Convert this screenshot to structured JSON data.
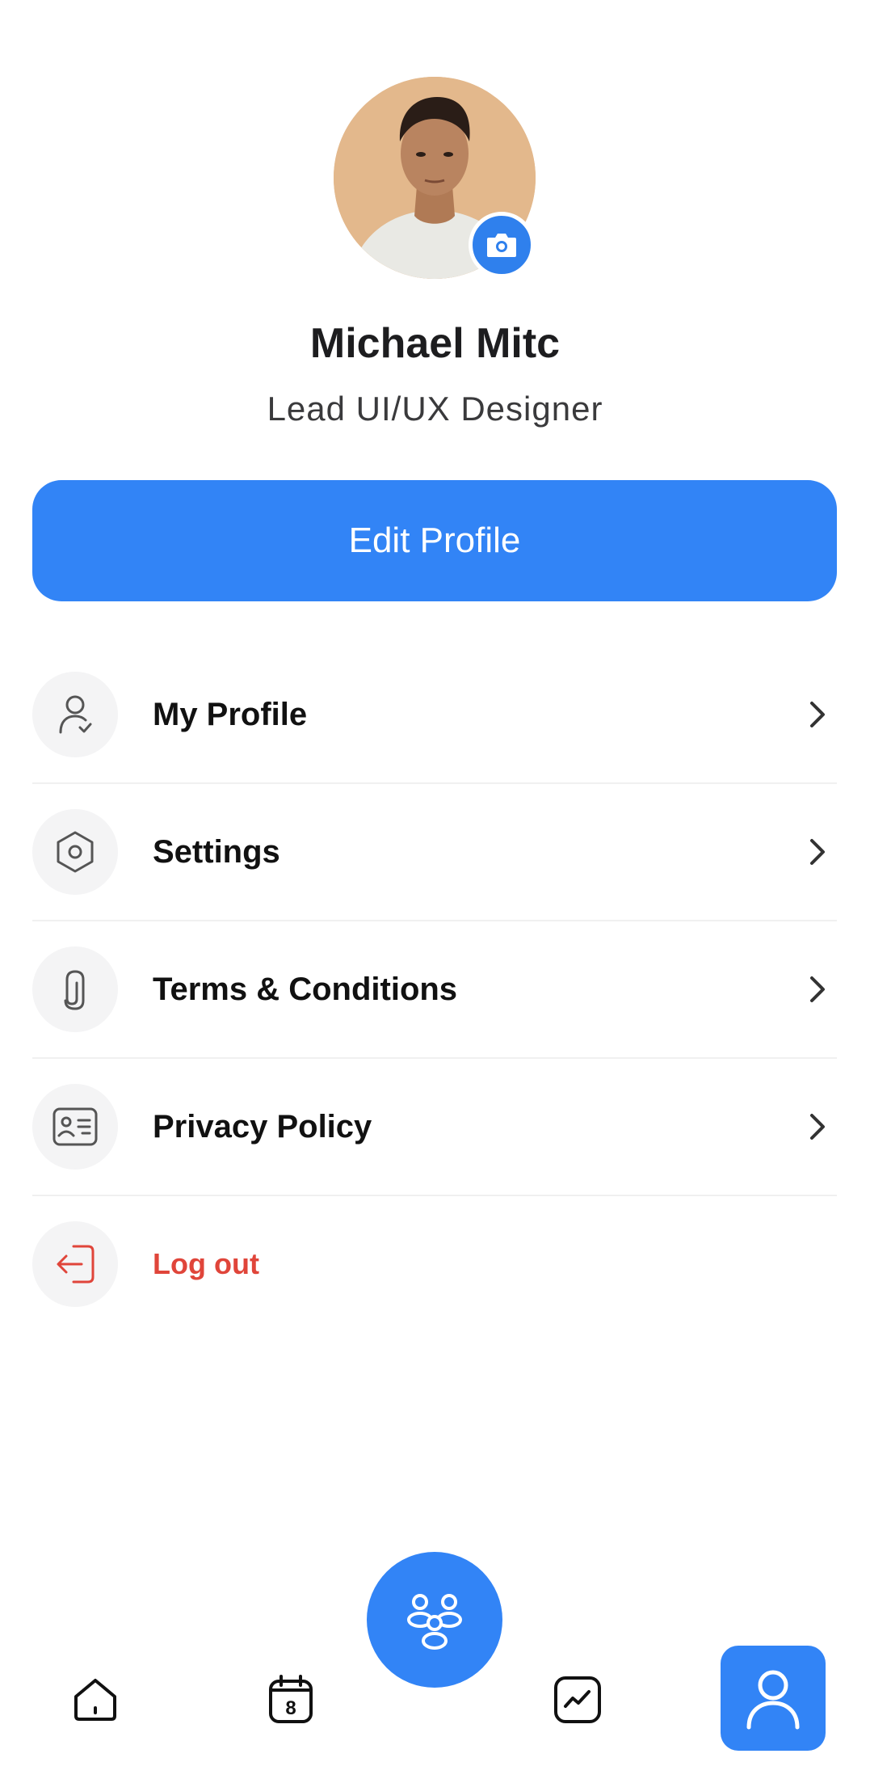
{
  "profile": {
    "name": "Michael Mitc",
    "role": "Lead UI/UX Designer",
    "edit_label": "Edit Profile"
  },
  "menu": {
    "items": [
      {
        "label": "My Profile",
        "icon": "user-check-icon"
      },
      {
        "label": "Settings",
        "icon": "settings-hexagon-icon"
      },
      {
        "label": "Terms & Conditions",
        "icon": "paperclip-icon"
      },
      {
        "label": "Privacy Policy",
        "icon": "id-card-icon"
      }
    ],
    "logout_label": "Log out"
  },
  "bottom_nav": {
    "items": [
      "home-icon",
      "calendar-icon",
      "team-icon",
      "chart-icon",
      "profile-icon"
    ],
    "calendar_day": "8",
    "active": "profile-icon"
  },
  "colors": {
    "accent": "#3284f6",
    "danger": "#e0453a"
  }
}
